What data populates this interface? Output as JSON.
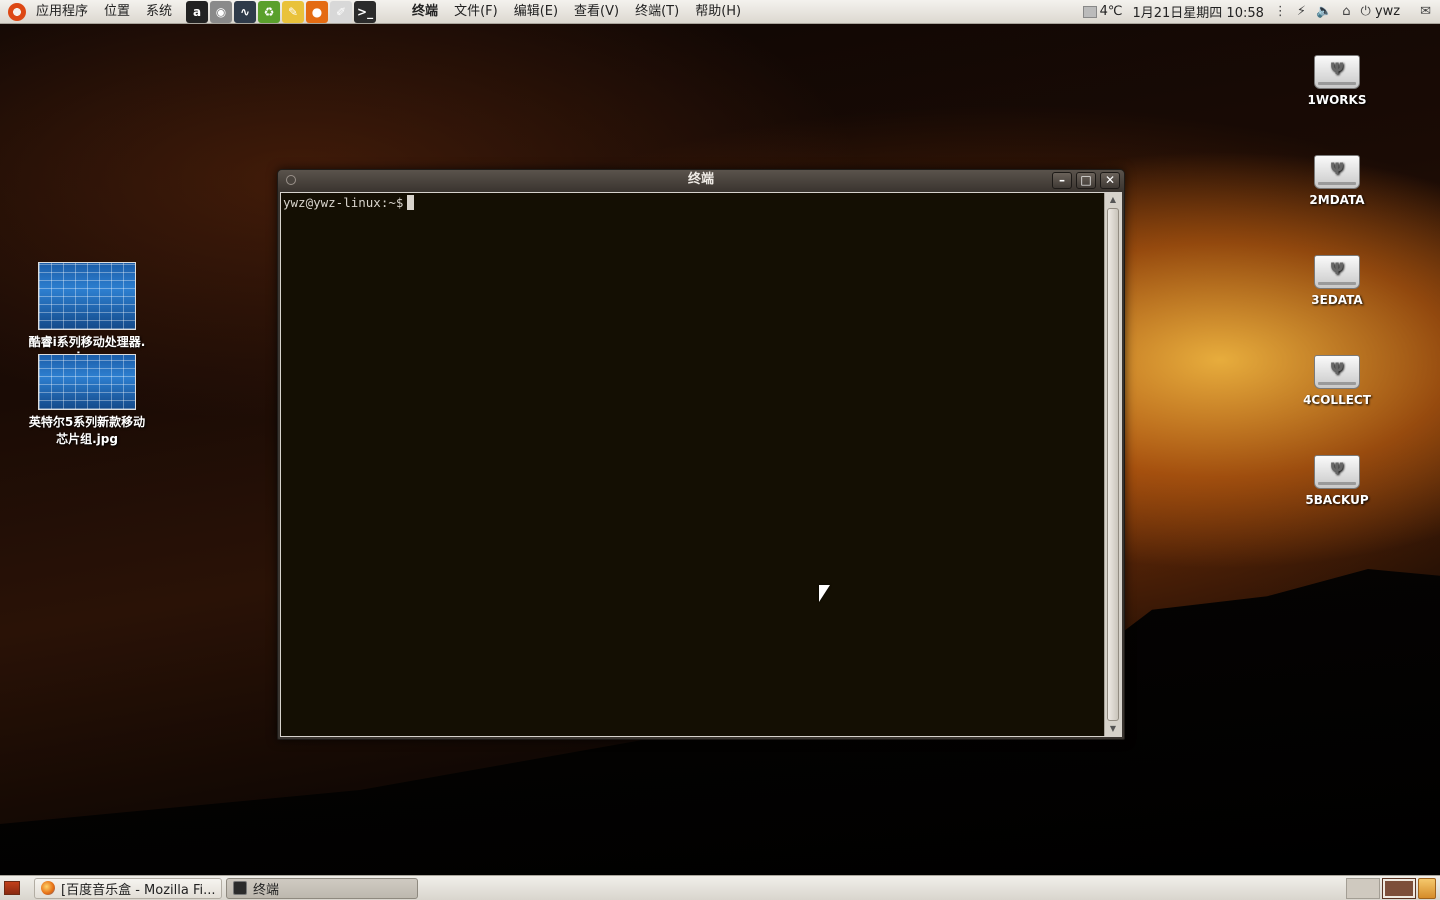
{
  "top_panel": {
    "menus": [
      "应用程序",
      "位置",
      "系统"
    ],
    "launchers": [
      {
        "icon": "amarok-icon",
        "glyph": "a",
        "color": "#222222"
      },
      {
        "icon": "camera-icon",
        "glyph": "◉",
        "color": "#8a8a8a"
      },
      {
        "icon": "system-monitor-icon",
        "glyph": "∿",
        "color": "#2f3b4a"
      },
      {
        "icon": "recycle-icon",
        "glyph": "♻",
        "color": "#5aa02c"
      },
      {
        "icon": "notes-icon",
        "glyph": "✎",
        "color": "#e9c23a"
      },
      {
        "icon": "firefox-icon",
        "glyph": "●",
        "color": "#e46b12"
      },
      {
        "icon": "text-editor-icon",
        "glyph": "✐",
        "color": "#d8d8d8"
      },
      {
        "icon": "terminal-icon",
        "glyph": ">_",
        "color": "#2b2b2b"
      }
    ],
    "app_menu": [
      "终端",
      "文件(F)",
      "编辑(E)",
      "查看(V)",
      "终端(T)",
      "帮助(H)"
    ],
    "tray": {
      "temperature": "4℃",
      "datetime": "1月21日星期四 10:58",
      "user": "ywz"
    }
  },
  "desktop": {
    "drives": [
      "1WORKS",
      "2MDATA",
      "3EDATA",
      "4COLLECT",
      "5BACKUP"
    ],
    "files": [
      {
        "name_line1": "酷睿i系列移动处理器.",
        "name_line2": "jpg"
      },
      {
        "name_line1": "英特尔5系列新款移动",
        "name_line2": "芯片组.jpg"
      }
    ]
  },
  "terminal": {
    "title": "终端",
    "prompt": "ywz@ywz-linux:~$"
  },
  "taskbar": {
    "tasks": [
      {
        "label": "[百度音乐盒 - Mozilla Fi...",
        "icon": "firefox-icon"
      },
      {
        "label": "终端",
        "icon": "terminal-icon"
      }
    ]
  }
}
